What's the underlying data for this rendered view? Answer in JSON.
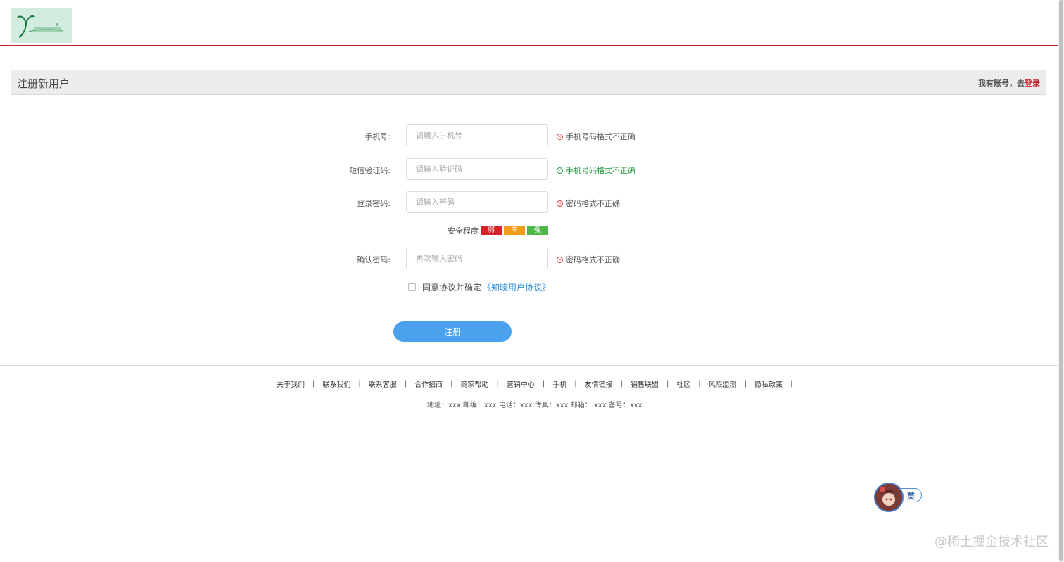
{
  "header": {
    "logo_icon": "script-y-logo-icon",
    "brand_color": "#c3232f"
  },
  "title_bar": {
    "title": "注册新用户",
    "account_prefix": "我有账号，去",
    "login_link": "登录"
  },
  "form": {
    "phone": {
      "label": "手机号:",
      "placeholder": "请输入手机号",
      "hint": "手机号码格式不正确",
      "hint_state": "error"
    },
    "sms_code": {
      "label": "短信验证码:",
      "placeholder": "请输入验证码",
      "hint": "手机号码格式不正确",
      "hint_state": "ok"
    },
    "password": {
      "label": "登录密码:",
      "placeholder": "请输入密码",
      "hint": "密码格式不正确",
      "hint_state": "error"
    },
    "strength": {
      "label": "安全程度",
      "weak": "弱",
      "medium": "中",
      "strong": "强"
    },
    "confirm_password": {
      "label": "确认密码:",
      "placeholder": "再次输入密码",
      "hint": "密码格式不正确",
      "hint_state": "error"
    },
    "agree": {
      "text": "同意协议并确定",
      "link": "《知晓用户协议》",
      "checked": false
    },
    "submit_label": "注册"
  },
  "footer": {
    "links": [
      "关于我们",
      "联系我们",
      "联系客服",
      "合作招商",
      "商家帮助",
      "营销中心",
      "手机",
      "友情链接",
      "销售联盟",
      "社区",
      "风险监测",
      "隐私政策"
    ],
    "separator": "|",
    "info": "地址：xxx 邮编：xxx 电话：xxx 传真：xxx 邮箱： xxx 备号：xxx"
  },
  "widget": {
    "label": "英",
    "avatar_icon": "anime-avatar-icon"
  },
  "watermark": "@稀土掘金技术社区",
  "colors": {
    "error_icon": "#dd3333",
    "ok": "#1e9a3a",
    "button": "#4aa2ee",
    "link": "#2b8ed6"
  }
}
